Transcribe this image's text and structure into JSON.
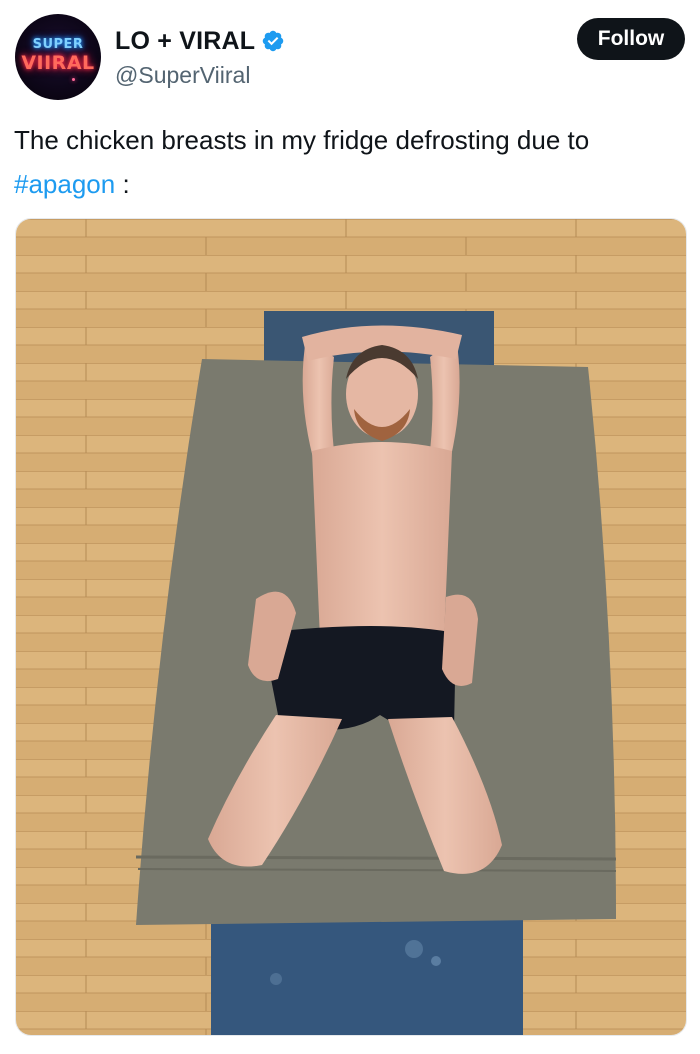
{
  "author": {
    "avatar_text_top": "SUPER",
    "avatar_text_bottom": "VIIRAL",
    "display_name": "LO + VIRAL",
    "handle": "@SuperViiral",
    "verified": true,
    "verified_color": "#1d9bf0"
  },
  "follow": {
    "label": "Follow"
  },
  "post": {
    "text_before": "The chicken breasts in my fridge defrosting due to",
    "hashtag": "#apagon",
    "text_after": " :"
  },
  "media": {
    "description_icon": "photo"
  },
  "colors": {
    "text": "#0f1419",
    "secondary": "#536471",
    "link": "#1d9bf0",
    "button": "#0f1419"
  }
}
